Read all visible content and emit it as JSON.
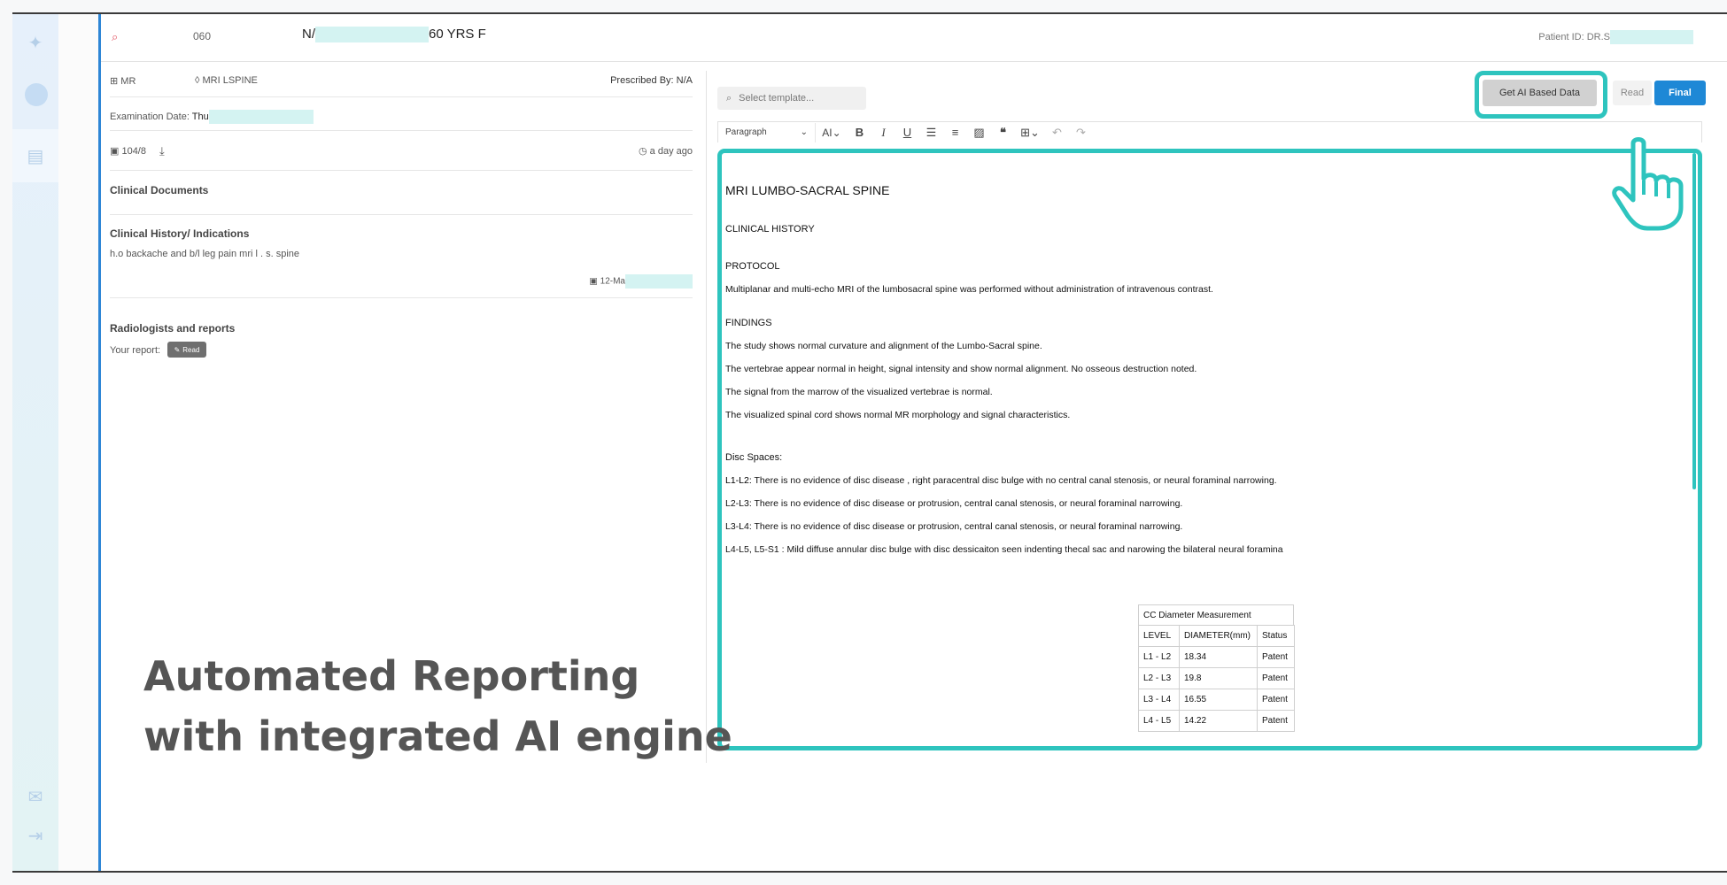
{
  "topbar": {
    "patient_code": "060",
    "patient_name": "N/",
    "patient_age_sex": "60 YRS F",
    "patient_id_label": "Patient ID: DR.S"
  },
  "info": {
    "modality": "MR",
    "body_part": "MRI LSPINE",
    "prescribed_by": "Prescribed By: N/A",
    "exam_date_label": "Examination Date:",
    "exam_date_value": "Thu",
    "images_count": "104/8",
    "last_updated": "a day ago",
    "clinical_documents_title": "Clinical Documents",
    "clinical_history_title": "Clinical History/ Indications",
    "clinical_history_text": "h.o backache and b/l leg pain mri l . s. spine",
    "history_date": "12-Ma",
    "radiologists_title": "Radiologists and reports",
    "your_report_label": "Your report:",
    "your_report_status": "Read"
  },
  "editor_controls": {
    "template_placeholder": "Select template...",
    "ai_button": "Get AI Based Data",
    "read_button": "Read",
    "final_button": "Final",
    "paragraph_select": "Paragraph",
    "font_size_label": "AI"
  },
  "report": {
    "title": "MRI LUMBO-SACRAL SPINE",
    "clinical_history": "CLINICAL HISTORY",
    "protocol_heading": "PROTOCOL",
    "protocol_text": "Multiplanar and multi-echo MRI of the lumbosacral spine was performed without administration of intravenous contrast.",
    "findings_heading": "FINDINGS",
    "findings": [
      "The study shows normal curvature and alignment of the Lumbo-Sacral spine.",
      "The vertebrae appear normal in height, signal intensity and show normal alignment. No osseous destruction noted.",
      "The signal from the marrow of the visualized vertebrae is normal.",
      "The visualized spinal cord shows normal MR morphology and signal characteristics."
    ],
    "disc_spaces_heading": "Disc Spaces:",
    "disc_spaces": [
      {
        "level": "L1-L2:",
        "text": " There is no evidence of disc disease , right paracentral disc bulge with no central canal stenosis, or neural foraminal narrowing."
      },
      {
        "level": "L2-L3:",
        "text": " There is no evidence of disc disease or protrusion, central canal stenosis, or neural foraminal narrowing."
      },
      {
        "level": "L3-L4:",
        "text": " There is no evidence of disc disease or protrusion, central canal stenosis, or neural foraminal narrowing."
      },
      {
        "level": "L4-L5, L5-S1 :",
        "text": " Mild diffuse annular disc bulge with disc dessicaiton seen indenting thecal sac and narowing the bilateral neural foramina"
      }
    ],
    "cc_table": {
      "caption": "CC Diameter Measurement",
      "headers": [
        "LEVEL",
        "DIAMETER(mm)",
        "Status"
      ],
      "rows": [
        [
          "L1 - L2",
          "18.34",
          "Patent"
        ],
        [
          "L2 - L3",
          "19.8",
          "Patent"
        ],
        [
          "L3 - L4",
          "16.55",
          "Patent"
        ],
        [
          "L4 - L5",
          "14.22",
          "Patent"
        ]
      ]
    }
  },
  "overlay": {
    "line1": "Automated Reporting",
    "line2": "with integrated AI engine"
  },
  "colors": {
    "accent": "#2ec4be",
    "primary": "#1e88d6",
    "highlight_redaction": "#d4f3f2"
  }
}
